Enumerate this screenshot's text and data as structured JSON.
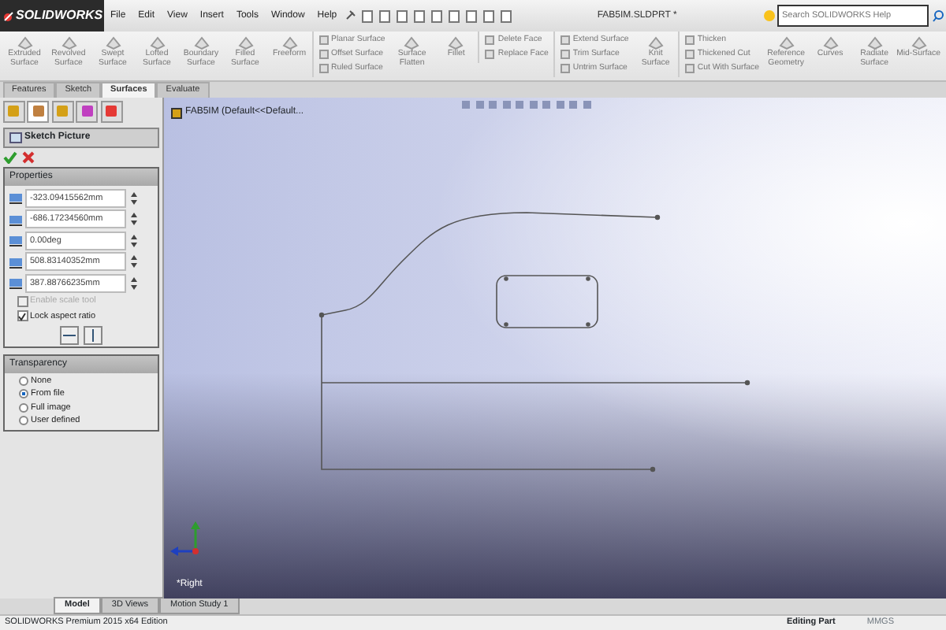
{
  "title_bar": {
    "logo": "SOLIDWORKS",
    "menu": [
      "File",
      "Edit",
      "View",
      "Insert",
      "Tools",
      "Window",
      "Help"
    ],
    "document_title": "FAB5IM.SLDPRT *",
    "search": {
      "placeholder": "Search SOLIDWORKS Help"
    }
  },
  "ribbon": [
    {
      "kind": "large",
      "label": "Extruded Surface"
    },
    {
      "kind": "large",
      "label": "Revolved Surface"
    },
    {
      "kind": "large",
      "label": "Swept Surface"
    },
    {
      "kind": "large",
      "label": "Lofted Surface"
    },
    {
      "kind": "large",
      "label": "Boundary Surface"
    },
    {
      "kind": "large",
      "label": "Filled Surface"
    },
    {
      "kind": "large",
      "label": "Freeform"
    },
    {
      "kind": "stack",
      "items": [
        "Planar Surface",
        "Offset Surface",
        "Ruled Surface"
      ]
    },
    {
      "kind": "large",
      "label": "Surface Flatten"
    },
    {
      "kind": "large",
      "label": "Fillet"
    },
    {
      "kind": "stack",
      "items": [
        "Delete Face",
        "Replace Face"
      ]
    },
    {
      "kind": "stack",
      "items": [
        "Extend Surface",
        "Trim Surface",
        "Untrim Surface"
      ]
    },
    {
      "kind": "large",
      "label": "Knit Surface"
    },
    {
      "kind": "stack",
      "items": [
        "Thicken",
        "Thickened Cut",
        "Cut With Surface"
      ]
    },
    {
      "kind": "large",
      "label": "Reference Geometry"
    },
    {
      "kind": "large",
      "label": "Curves"
    },
    {
      "kind": "large",
      "label": "Radiate Surface"
    },
    {
      "kind": "large",
      "label": "Mid-Surface"
    }
  ],
  "command_tabs": [
    {
      "label": "Features",
      "selected": false
    },
    {
      "label": "Sketch",
      "selected": false
    },
    {
      "label": "Surfaces",
      "selected": true
    },
    {
      "label": "Evaluate",
      "selected": false
    }
  ],
  "manager_tabs": [
    {
      "selected": false
    },
    {
      "selected": true
    },
    {
      "selected": false
    },
    {
      "selected": false
    },
    {
      "selected": false
    }
  ],
  "property_manager": {
    "title": "Sketch Picture",
    "properties": {
      "title": "Properties",
      "fields": [
        "-323.09415562mm",
        "-686.17234560mm",
        "0.00deg",
        "508.83140352mm",
        "387.88766235mm"
      ],
      "options": [
        {
          "label": "Enable scale tool",
          "checked": false,
          "disabled": true
        },
        {
          "label": "Lock aspect ratio",
          "checked": true,
          "disabled": false
        }
      ]
    },
    "transparency": {
      "title": "Transparency",
      "options": [
        {
          "label": "None",
          "selected": false
        },
        {
          "label": "From file",
          "selected": true
        },
        {
          "label": "Full image",
          "selected": false
        },
        {
          "label": "User defined",
          "selected": false
        }
      ]
    }
  },
  "viewport": {
    "tree_item": "FAB5IM  (Default<<Default...",
    "view_label": "*Right"
  },
  "bottom_tabs": [
    {
      "label": "Model",
      "selected": true
    },
    {
      "label": "3D Views",
      "selected": false
    },
    {
      "label": "Motion Study 1",
      "selected": false
    }
  ],
  "status_bar": {
    "product": "SOLIDWORKS Premium 2015 x64 Edition",
    "mode": "Editing Part",
    "units": "MMGS"
  }
}
